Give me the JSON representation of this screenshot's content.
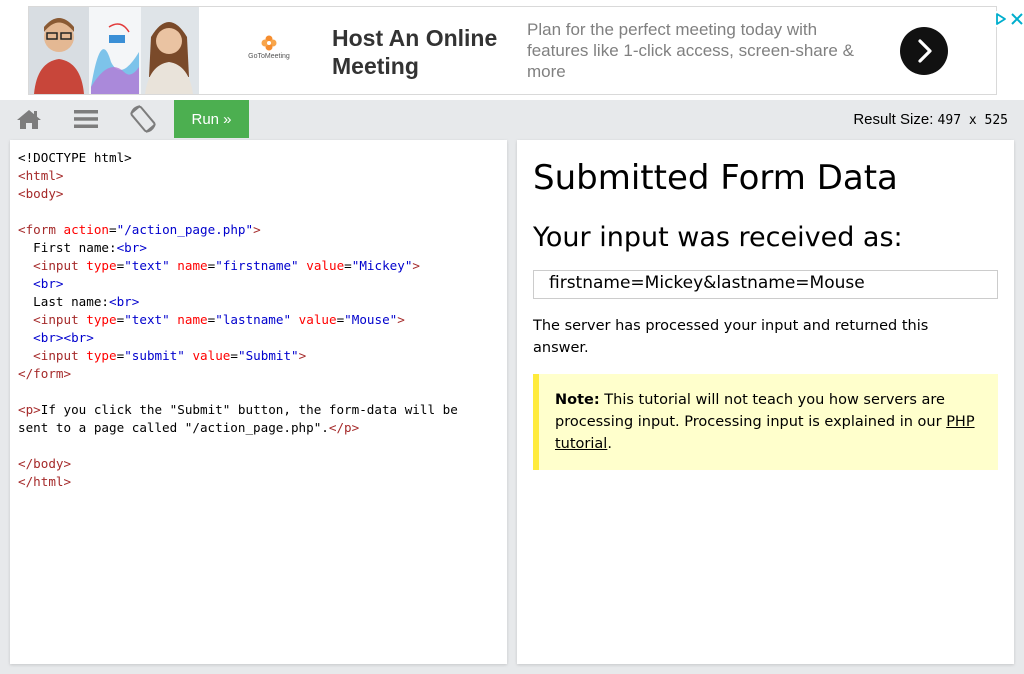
{
  "ad": {
    "brand": "GoToMeeting",
    "headline": "Host An Online Meeting",
    "body": "Plan for the perfect meeting today with features like 1-click access, screen-share & more",
    "icons": {
      "cta": "chevron-right-icon",
      "ad_choices": "ad-choices-icon",
      "close": "close-icon"
    }
  },
  "toolbar": {
    "icons": [
      "home-icon",
      "menu-icon",
      "rotate-icon"
    ],
    "run_label": "Run »",
    "result_size_label": "Result Size:",
    "result_size_value": "497 x 525",
    "run_color": "#4caf50"
  },
  "code": {
    "lines": [
      "<!DOCTYPE html>",
      "<html>",
      "<body>",
      "",
      "<form action=\"/action_page.php\">",
      "  First name:<br>",
      "  <input type=\"text\" name=\"firstname\" value=\"Mickey\">",
      "  <br>",
      "  Last name:<br>",
      "  <input type=\"text\" name=\"lastname\" value=\"Mouse\">",
      "  <br><br>",
      "  <input type=\"submit\" value=\"Submit\">",
      "</form>",
      "",
      "<p>If you click the \"Submit\" button, the form-data will be",
      "sent to a page called \"/action_page.php\".</p>",
      "",
      "</body>",
      "</html>"
    ]
  },
  "result": {
    "title": "Submitted Form Data",
    "subtitle": "Your input was received as:",
    "query_string": "firstname=Mickey&lastname=Mouse",
    "message": "The server has processed your input and returned this answer.",
    "note_label": "Note:",
    "note_text": " This tutorial will not teach you how servers are processing input. Processing input is explained in our ",
    "note_link": "PHP tutorial",
    "note_end": "."
  }
}
